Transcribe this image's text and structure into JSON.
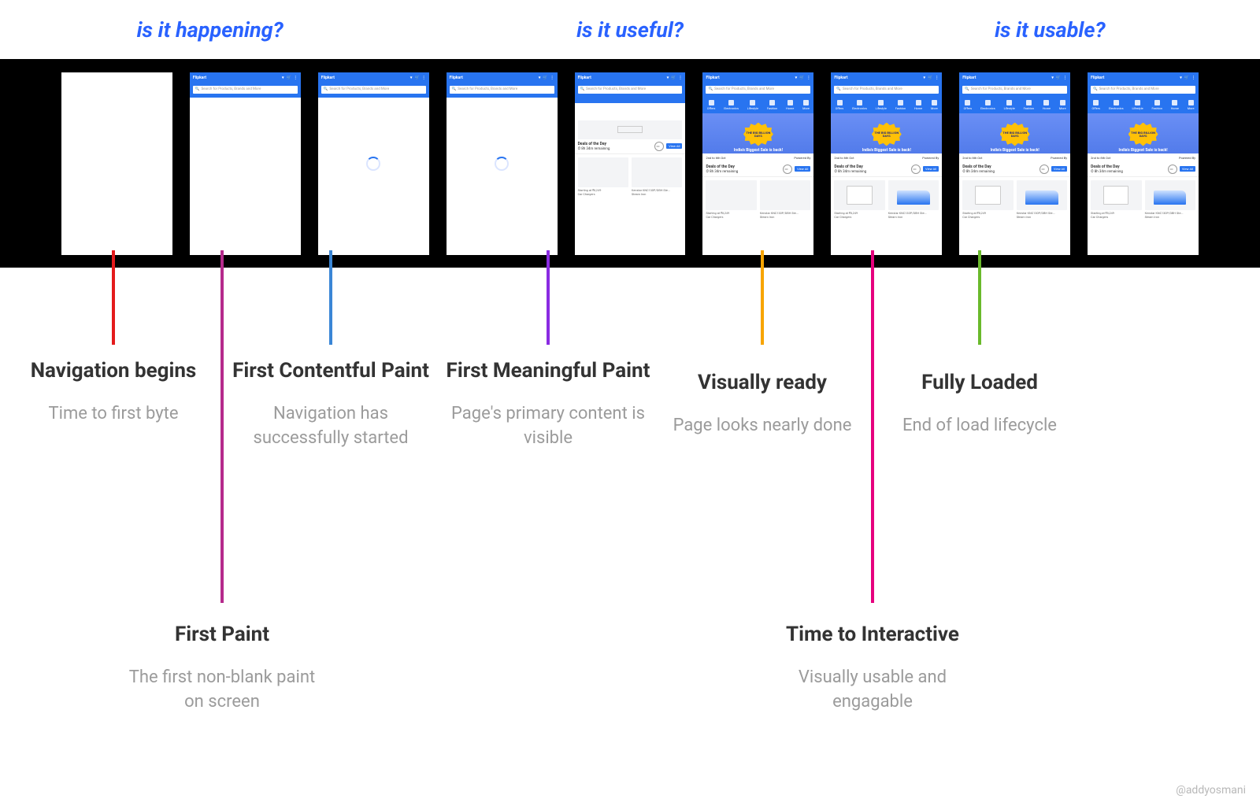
{
  "questions": {
    "q1": "is it happening?",
    "q2": "is it useful?",
    "q3": "is it usable?"
  },
  "phone": {
    "brand": "Flipkart",
    "search_placeholder": "Search for Products, Brands and More",
    "categories": [
      "Offers",
      "Electronics",
      "Lifestyle",
      "Fashion",
      "Home",
      "More"
    ],
    "banner_badge": "THE BIG BILLION DAYS",
    "banner_tag": "India's Biggest Sale is back!",
    "banner_dates": "2nd to 6th Oct",
    "banner_powered": "Powered By",
    "deals_title": "Deals of the Day",
    "deals_time": "8h 34m remaining",
    "view_all": "View All",
    "prod1_line1": "Starting at ₹8,249",
    "prod1_line2": "Car Chargers",
    "prod2_line1": "Kenstar KNC130P/DBH Ste...",
    "prod2_line2": "Steam Iron"
  },
  "milestones": {
    "nav": {
      "title": "Navigation begins",
      "desc": "Time to first byte"
    },
    "fp": {
      "title": "First Paint",
      "desc": "The first non-blank paint on screen"
    },
    "fcp": {
      "title": "First Contentful Paint",
      "desc": "Navigation has successfully started"
    },
    "fmp": {
      "title": "First Meaningful Paint",
      "desc": "Page's primary content is visible"
    },
    "vr": {
      "title": "Visually ready",
      "desc": "Page looks nearly done"
    },
    "tti": {
      "title": "Time to Interactive",
      "desc": "Visually usable and engagable"
    },
    "fl": {
      "title": "Fully Loaded",
      "desc": "End of load lifecycle"
    }
  },
  "colors": {
    "nav": "#e41a1c",
    "fp": "#b52a8c",
    "fcp": "#3a86d6",
    "fmp": "#8a2be2",
    "vr": "#f7a400",
    "tti": "#e6007e",
    "fl": "#6aba2b"
  },
  "credit": "@addyosmani"
}
